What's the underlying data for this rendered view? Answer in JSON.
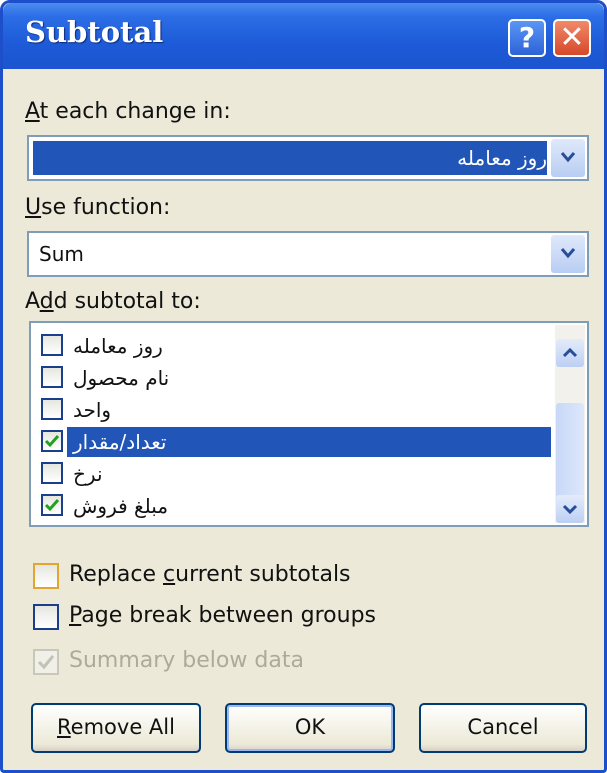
{
  "dialog": {
    "title": "Subtotal",
    "help_glyph": "?",
    "close_glyph": "✕"
  },
  "at_each_change": {
    "label_accel": "A",
    "label_rest": "t each change in:",
    "value": "روز معامله"
  },
  "use_function": {
    "label_accel": "U",
    "label_rest": "se function:",
    "value": "Sum"
  },
  "add_subtotal": {
    "label_pre": "A",
    "label_accel": "d",
    "label_rest": "d subtotal to:",
    "items": [
      {
        "label": "روز معامله",
        "checked": false,
        "selected": false
      },
      {
        "label": "نام محصول",
        "checked": false,
        "selected": false
      },
      {
        "label": "واحد",
        "checked": false,
        "selected": false
      },
      {
        "label": "تعداد/مقدار",
        "checked": true,
        "selected": true
      },
      {
        "label": "نرخ",
        "checked": false,
        "selected": false
      },
      {
        "label": "مبلغ فروش",
        "checked": true,
        "selected": false
      }
    ]
  },
  "options": {
    "replace_pre": "Replace ",
    "replace_accel": "c",
    "replace_rest": "urrent subtotals",
    "pagebreak_accel": "P",
    "pagebreak_rest": "age break between groups",
    "summary_label": "Summary below data"
  },
  "buttons": {
    "remove_accel": "R",
    "remove_rest": "emove All",
    "ok": "OK",
    "cancel": "Cancel"
  },
  "colors": {
    "titlebar": "#1e5bd8",
    "selection": "#2255b8",
    "checkmark": "#21a121"
  }
}
